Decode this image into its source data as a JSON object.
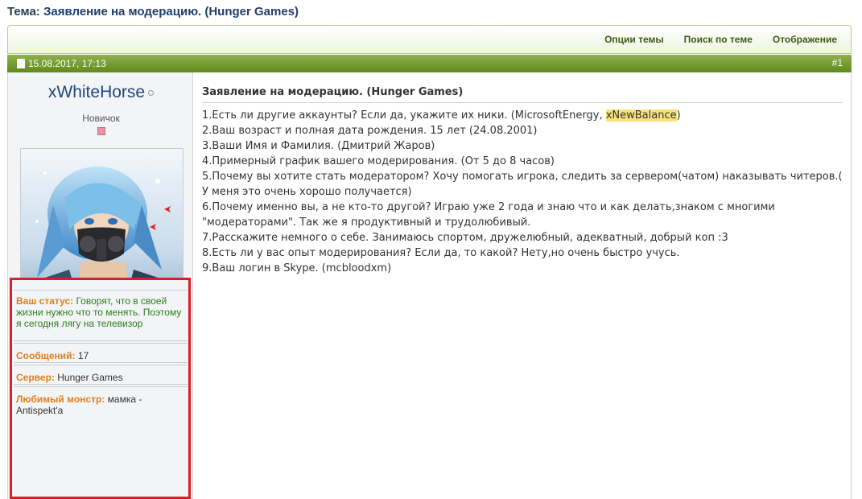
{
  "topic": {
    "label": "Тема:",
    "name": "Заявление на модерацию. (Hunger Games)"
  },
  "toolbar": {
    "items": [
      "Опции темы",
      "Поиск по теме",
      "Отображение"
    ]
  },
  "post": {
    "date": "15.08.2017, 17:13",
    "number": "#1",
    "title": "Заявление на модерацию. (Hunger Games)",
    "lines": [
      "1.Есть ли другие аккаунты? Если да, укажите их ники. (MicrosoftEnergy, ",
      "2.Ваш возраст и полная дата рождения. 15 лет (24.08.2001)",
      "3.Ваши Имя и Фамилия. (Дмитрий Жаров)",
      "4.Примерный график вашего модерирования. (От 5 до 8 часов)",
      "5.Почему вы хотите стать модератором? Хочу помогать игрока, следить за сервером(чатом) наказывать читеров.( У меня это очень хорошо получается)",
      "6.Почему именно вы, а не кто-то другой? Играю уже 2 года и знаю что и как делать,знаком с многими \"модераторами\". Так же я продуктивный и трудолюбивый.",
      "7.Расскажите немного о себе. Занимаюсь спортом, дружелюбный, адекватный, добрый коп :3",
      "8.Есть ли у вас опыт модерирования? Если да, то какой? Нету,но очень быстро учусь.",
      "9.Ваш логин в Skype. (mcbloodxm)"
    ],
    "line1_highlight": "xNewBalance",
    "line1_end": ")"
  },
  "user": {
    "name": "xWhiteHorse",
    "title": "Новичок",
    "status_label": "Ваш статус:",
    "status_value": "Говорят, что в своей жизни нужно что то менять. Поэтому я сегодня лягу на телевизор",
    "posts_label": "Сообщений:",
    "posts_value": "17",
    "server_label": "Сервер:",
    "server_value": "Hunger Games",
    "monster_label": "Любимый монстр:",
    "monster_value": "мамка - Antispekt'a"
  },
  "colors": {
    "accent_green": "#5e8b1c",
    "highlight_box": "#d62028",
    "label_orange": "#e07f1a"
  }
}
